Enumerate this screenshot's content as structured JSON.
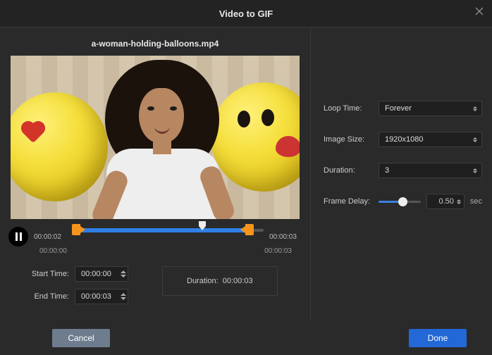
{
  "title": "Video to GIF",
  "filename": "a-woman-holding-balloons.mp4",
  "playbar": {
    "current": "00:00:02",
    "end": "00:00:03",
    "range_start": "00:00:00",
    "range_end": "00:00:03"
  },
  "time": {
    "start_label": "Start Time:",
    "start_value": "00:00:00",
    "end_label": "End Time:",
    "end_value": "00:00:03",
    "duration_label": "Duration:",
    "duration_value": "00:00:03"
  },
  "options": {
    "loop_label": "Loop Time:",
    "loop_value": "Forever",
    "size_label": "Image Size:",
    "size_value": "1920x1080",
    "duration_label": "Duration:",
    "duration_value": "3",
    "delay_label": "Frame Delay:",
    "delay_value": "0.50",
    "delay_unit": "sec"
  },
  "buttons": {
    "cancel": "Cancel",
    "done": "Done"
  }
}
